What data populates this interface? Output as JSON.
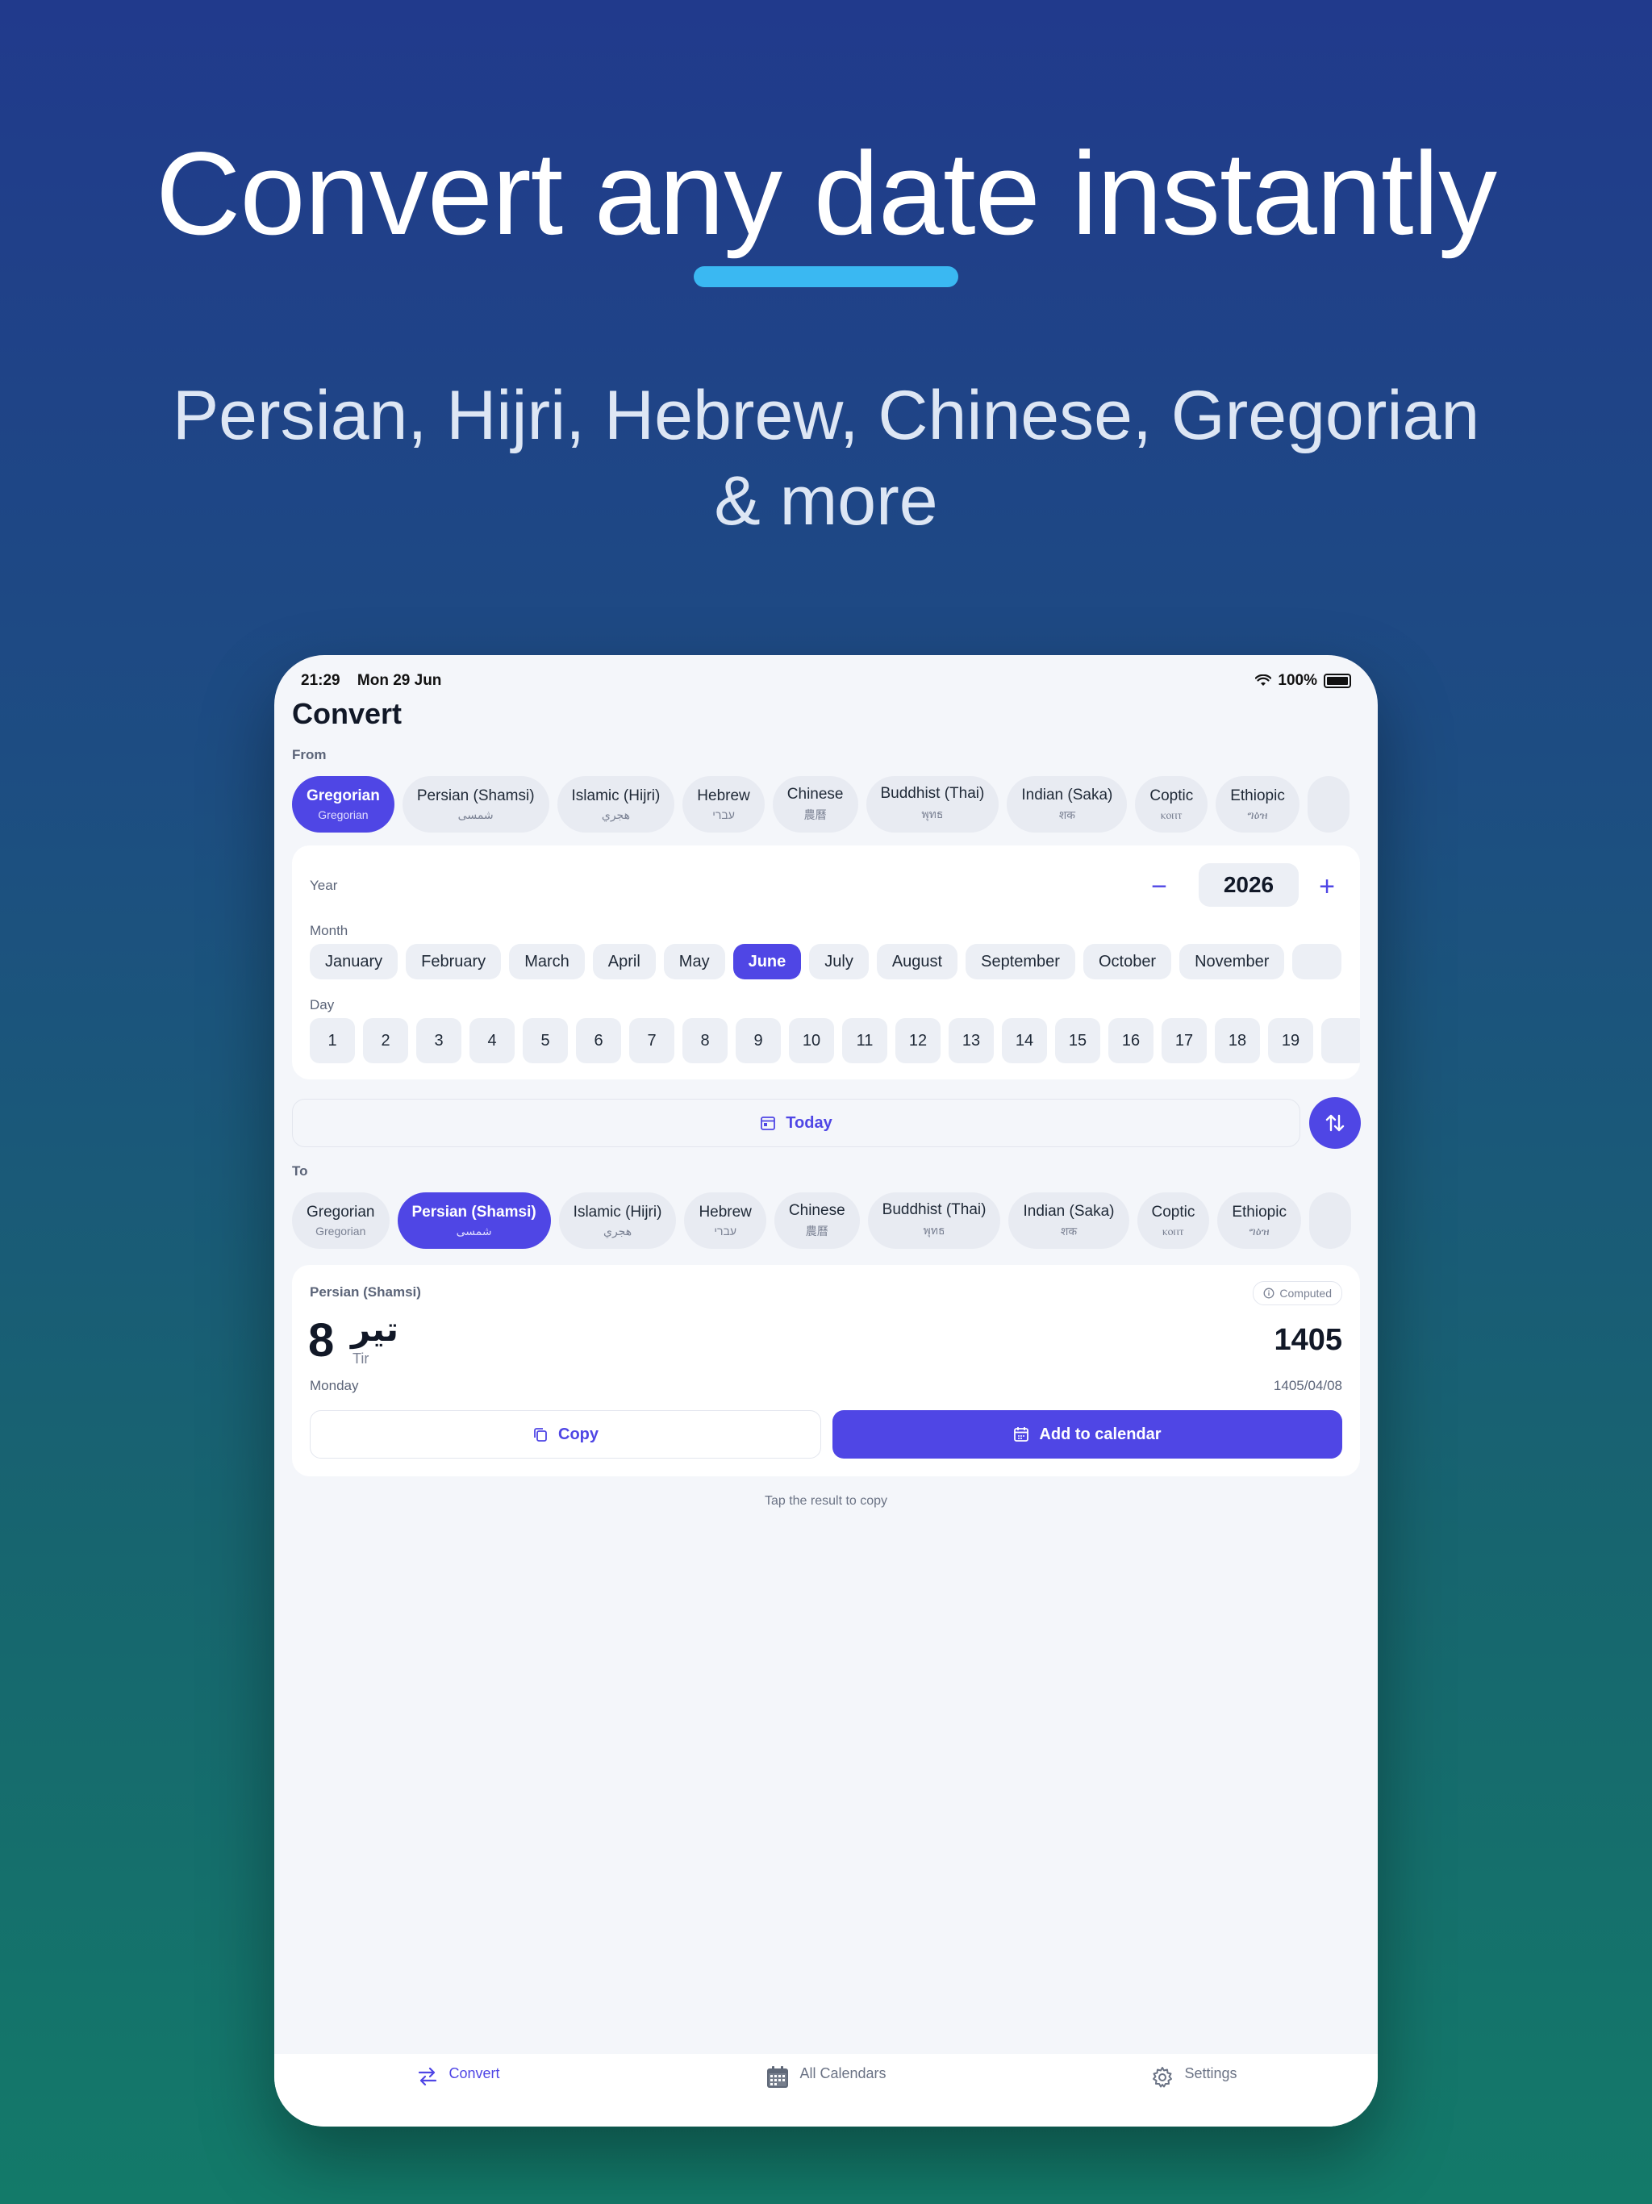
{
  "hero": {
    "title": "Convert any date instantly",
    "subtitle": "Persian, Hijri, Hebrew, Chinese, Gregorian & more"
  },
  "status_bar": {
    "time": "21:29",
    "date": "Mon 29 Jun",
    "battery": "100%"
  },
  "screen": {
    "title": "Convert"
  },
  "from": {
    "label": "From",
    "calendars": [
      {
        "name": "Gregorian",
        "native": "Gregorian",
        "selected": true
      },
      {
        "name": "Persian (Shamsi)",
        "native": "شمسی",
        "selected": false
      },
      {
        "name": "Islamic (Hijri)",
        "native": "هجري",
        "selected": false
      },
      {
        "name": "Hebrew",
        "native": "עברי",
        "selected": false
      },
      {
        "name": "Chinese",
        "native": "農曆",
        "selected": false
      },
      {
        "name": "Buddhist (Thai)",
        "native": "พุทธ",
        "selected": false
      },
      {
        "name": "Indian (Saka)",
        "native": "शक",
        "selected": false
      },
      {
        "name": "Coptic",
        "native": "ⲕⲟⲡⲧ",
        "selected": false
      },
      {
        "name": "Ethiopic",
        "native": "ግዕዝ",
        "selected": false
      }
    ]
  },
  "picker": {
    "year_label": "Year",
    "year_value": "2026",
    "decrement": "−",
    "increment": "+",
    "month_label": "Month",
    "months": [
      "January",
      "February",
      "March",
      "April",
      "May",
      "June",
      "July",
      "August",
      "September",
      "October",
      "November"
    ],
    "selected_month": "June",
    "day_label": "Day",
    "days": [
      "1",
      "2",
      "3",
      "4",
      "5",
      "6",
      "7",
      "8",
      "9",
      "10",
      "11",
      "12",
      "13",
      "14",
      "15",
      "16",
      "17",
      "18",
      "19"
    ]
  },
  "today_button": "Today",
  "to": {
    "label": "To",
    "calendars": [
      {
        "name": "Gregorian",
        "native": "Gregorian",
        "selected": false
      },
      {
        "name": "Persian (Shamsi)",
        "native": "شمسی",
        "selected": true
      },
      {
        "name": "Islamic (Hijri)",
        "native": "هجري",
        "selected": false
      },
      {
        "name": "Hebrew",
        "native": "עברי",
        "selected": false
      },
      {
        "name": "Chinese",
        "native": "農曆",
        "selected": false
      },
      {
        "name": "Buddhist (Thai)",
        "native": "พุทธ",
        "selected": false
      },
      {
        "name": "Indian (Saka)",
        "native": "शक",
        "selected": false
      },
      {
        "name": "Coptic",
        "native": "ⲕⲟⲡⲧ",
        "selected": false
      },
      {
        "name": "Ethiopic",
        "native": "ግዕዝ",
        "selected": false
      }
    ]
  },
  "result": {
    "calendar": "Persian (Shamsi)",
    "badge": "Computed",
    "day": "8",
    "month_native": "تیر",
    "month_latin": "Tir",
    "year": "1405",
    "weekday": "Monday",
    "numeric": "1405/04/08",
    "copy_label": "Copy",
    "add_calendar_label": "Add to calendar"
  },
  "hint": "Tap the result to copy",
  "tabs": [
    {
      "label": "Convert",
      "icon": "arrows-swap-icon",
      "active": true
    },
    {
      "label": "All Calendars",
      "icon": "calendar-grid-icon",
      "active": false
    },
    {
      "label": "Settings",
      "icon": "gear-icon",
      "active": false
    }
  ],
  "colors": {
    "accent": "#4f46e5",
    "underline": "#3ab8f2",
    "background_top": "#213a8c",
    "background_bottom": "#137a69"
  }
}
